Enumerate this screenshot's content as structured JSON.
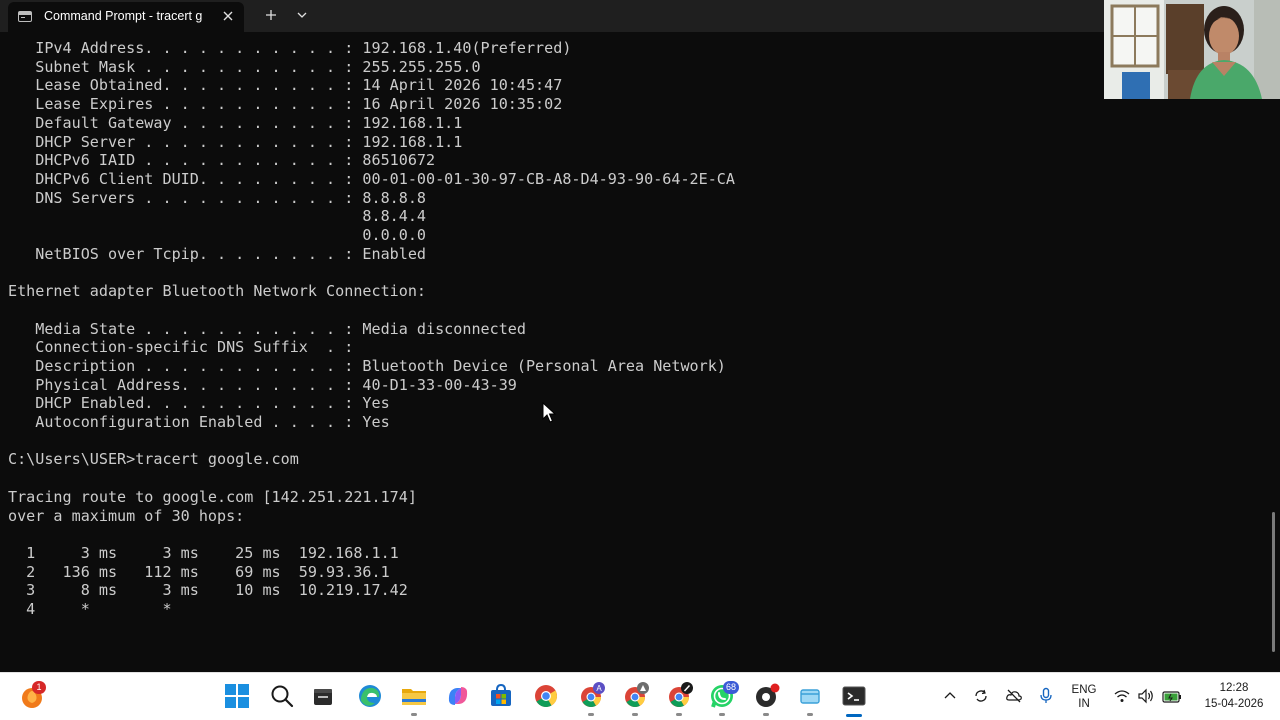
{
  "window": {
    "tab_title": "Command Prompt - tracert g",
    "tab_icon": "terminal-icon",
    "close_icon": "close-icon",
    "new_tab_icon": "plus-icon",
    "dropdown_icon": "chevron-down-icon"
  },
  "terminal": {
    "lines": [
      "   IPv4 Address. . . . . . . . . . . : 192.168.1.40(Preferred)",
      "   Subnet Mask . . . . . . . . . . . : 255.255.255.0",
      "   Lease Obtained. . . . . . . . . . : 14 April 2026 10:45:47",
      "   Lease Expires . . . . . . . . . . : 16 April 2026 10:35:02",
      "   Default Gateway . . . . . . . . . : 192.168.1.1",
      "   DHCP Server . . . . . . . . . . . : 192.168.1.1",
      "   DHCPv6 IAID . . . . . . . . . . . : 86510672",
      "   DHCPv6 Client DUID. . . . . . . . : 00-01-00-01-30-97-CB-A8-D4-93-90-64-2E-CA",
      "   DNS Servers . . . . . . . . . . . : 8.8.8.8",
      "                                       8.8.4.4",
      "                                       0.0.0.0",
      "   NetBIOS over Tcpip. . . . . . . . : Enabled",
      "",
      "Ethernet adapter Bluetooth Network Connection:",
      "",
      "   Media State . . . . . . . . . . . : Media disconnected",
      "   Connection-specific DNS Suffix  . :",
      "   Description . . . . . . . . . . . : Bluetooth Device (Personal Area Network)",
      "   Physical Address. . . . . . . . . : 40-D1-33-00-43-39",
      "   DHCP Enabled. . . . . . . . . . . : Yes",
      "   Autoconfiguration Enabled . . . . : Yes",
      "",
      "C:\\Users\\USER>tracert google.com",
      "",
      "Tracing route to google.com [142.251.221.174]",
      "over a maximum of 30 hops:",
      "",
      "  1     3 ms     3 ms    25 ms  192.168.1.1",
      "  2   136 ms   112 ms    69 ms  59.93.36.1",
      "  3     8 ms     3 ms    10 ms  10.219.17.42",
      "  4     *        *"
    ]
  },
  "taskbar": {
    "notification_badge": "1",
    "apps": [
      {
        "name": "start-button",
        "icon": "windows-start-icon"
      },
      {
        "name": "search-button",
        "icon": "search-icon"
      },
      {
        "name": "file-app-button",
        "icon": "file-app-icon"
      },
      {
        "name": "edge-button",
        "icon": "edge-icon"
      },
      {
        "name": "file-explorer-button",
        "icon": "folder-icon"
      },
      {
        "name": "copilot-button",
        "icon": "copilot-icon"
      },
      {
        "name": "store-button",
        "icon": "store-icon"
      },
      {
        "name": "chrome-button",
        "icon": "chrome-icon"
      },
      {
        "name": "chrome-profile-a-button",
        "icon": "chrome-icon"
      },
      {
        "name": "chrome-profile-b-button",
        "icon": "chrome-icon"
      },
      {
        "name": "chrome-profile-c-button",
        "icon": "chrome-icon"
      },
      {
        "name": "whatsapp-button",
        "icon": "whatsapp-icon"
      },
      {
        "name": "app-button",
        "icon": "app-icon"
      },
      {
        "name": "window-app-button",
        "icon": "window-icon"
      },
      {
        "name": "terminal-button",
        "icon": "terminal-icon"
      }
    ],
    "whatsapp_badge": "68",
    "language_primary": "ENG",
    "language_secondary": "IN",
    "time": "12:28",
    "date": "15-04-2026"
  },
  "colors": {
    "terminal_bg": "#0c0c0c",
    "terminal_text": "#cccccc",
    "titlebar_bg": "#1f1f1f",
    "taskbar_bg": "#ffffff",
    "accent": "#0067c0"
  }
}
